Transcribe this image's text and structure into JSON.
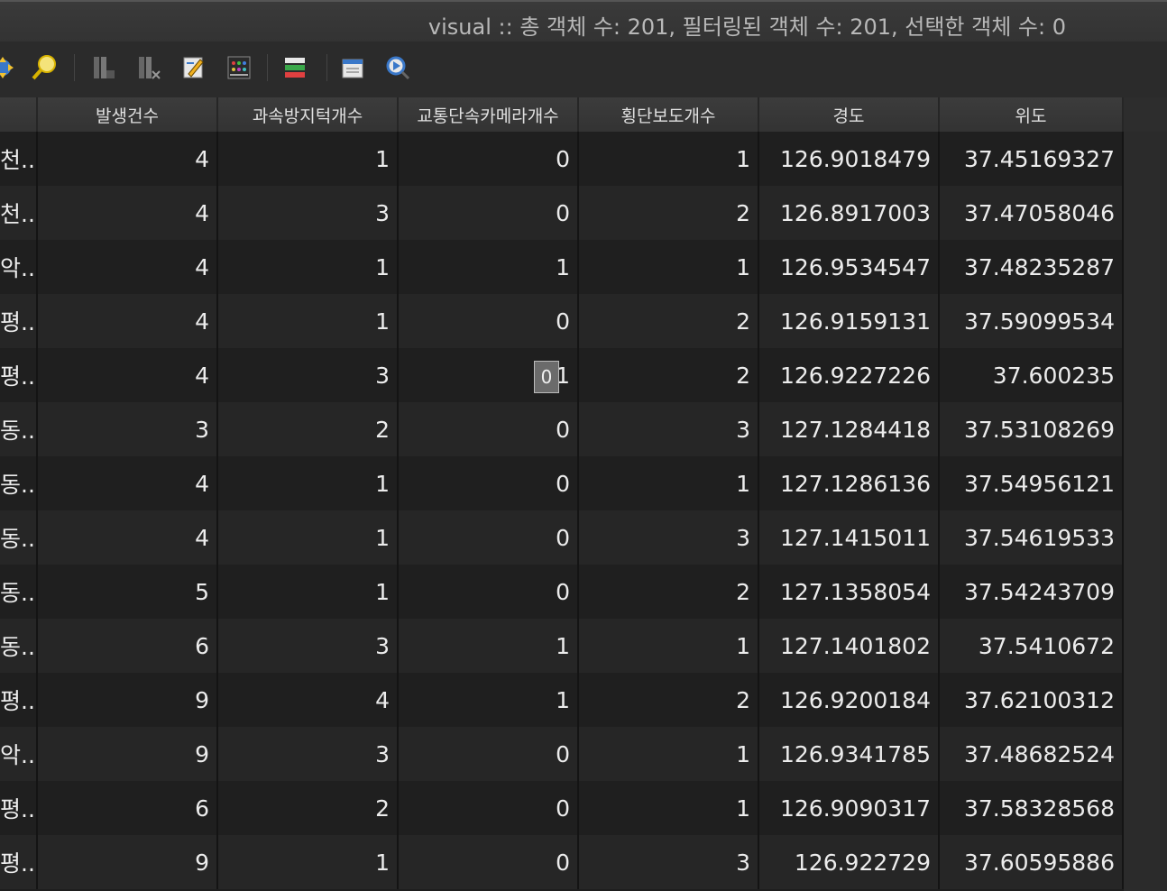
{
  "window": {
    "title": "visual :: 총 객체 수: 201, 필터링된 객체 수: 201, 선택한 객체 수: 0"
  },
  "toolbar": {
    "icons": [
      "pan-to-selected-icon",
      "zoom-to-selected-icon",
      "delete-field-icon",
      "new-field-icon",
      "field-calculator-icon",
      "conditional-formatting-icon",
      "organize-columns-icon",
      "dock-table-icon",
      "actions-icon"
    ]
  },
  "table": {
    "columns": [
      "",
      "발생건수",
      "과속방지턱개수",
      "교통단속카메라개수",
      "횡단보도개수",
      "경도",
      "위도"
    ],
    "rows": [
      [
        "천...",
        "4",
        "1",
        "0",
        "1",
        "126.9018479",
        "37.45169327"
      ],
      [
        "천...",
        "4",
        "3",
        "0",
        "2",
        "126.8917003",
        "37.47058046"
      ],
      [
        "악...",
        "4",
        "1",
        "1",
        "1",
        "126.9534547",
        "37.48235287"
      ],
      [
        "평...",
        "4",
        "1",
        "0",
        "2",
        "126.9159131",
        "37.59099534"
      ],
      [
        "평...",
        "4",
        "3",
        "1",
        "2",
        "126.9227226",
        "37.600235"
      ],
      [
        "동...",
        "3",
        "2",
        "0",
        "3",
        "127.1284418",
        "37.53108269"
      ],
      [
        "동...",
        "4",
        "1",
        "0",
        "1",
        "127.1286136",
        "37.54956121"
      ],
      [
        "동...",
        "4",
        "1",
        "0",
        "3",
        "127.1415011",
        "37.54619533"
      ],
      [
        "동...",
        "5",
        "1",
        "0",
        "2",
        "127.1358054",
        "37.54243709"
      ],
      [
        "동...",
        "6",
        "3",
        "1",
        "1",
        "127.1401802",
        "37.5410672"
      ],
      [
        "평...",
        "9",
        "4",
        "1",
        "2",
        "126.9200184",
        "37.62100312"
      ],
      [
        "악...",
        "9",
        "3",
        "0",
        "1",
        "126.9341785",
        "37.48682524"
      ],
      [
        "평...",
        "6",
        "2",
        "0",
        "1",
        "126.9090317",
        "37.58328568"
      ],
      [
        "평...",
        "9",
        "1",
        "0",
        "3",
        "126.922729",
        "37.60595886"
      ]
    ],
    "editor_value": "0"
  }
}
